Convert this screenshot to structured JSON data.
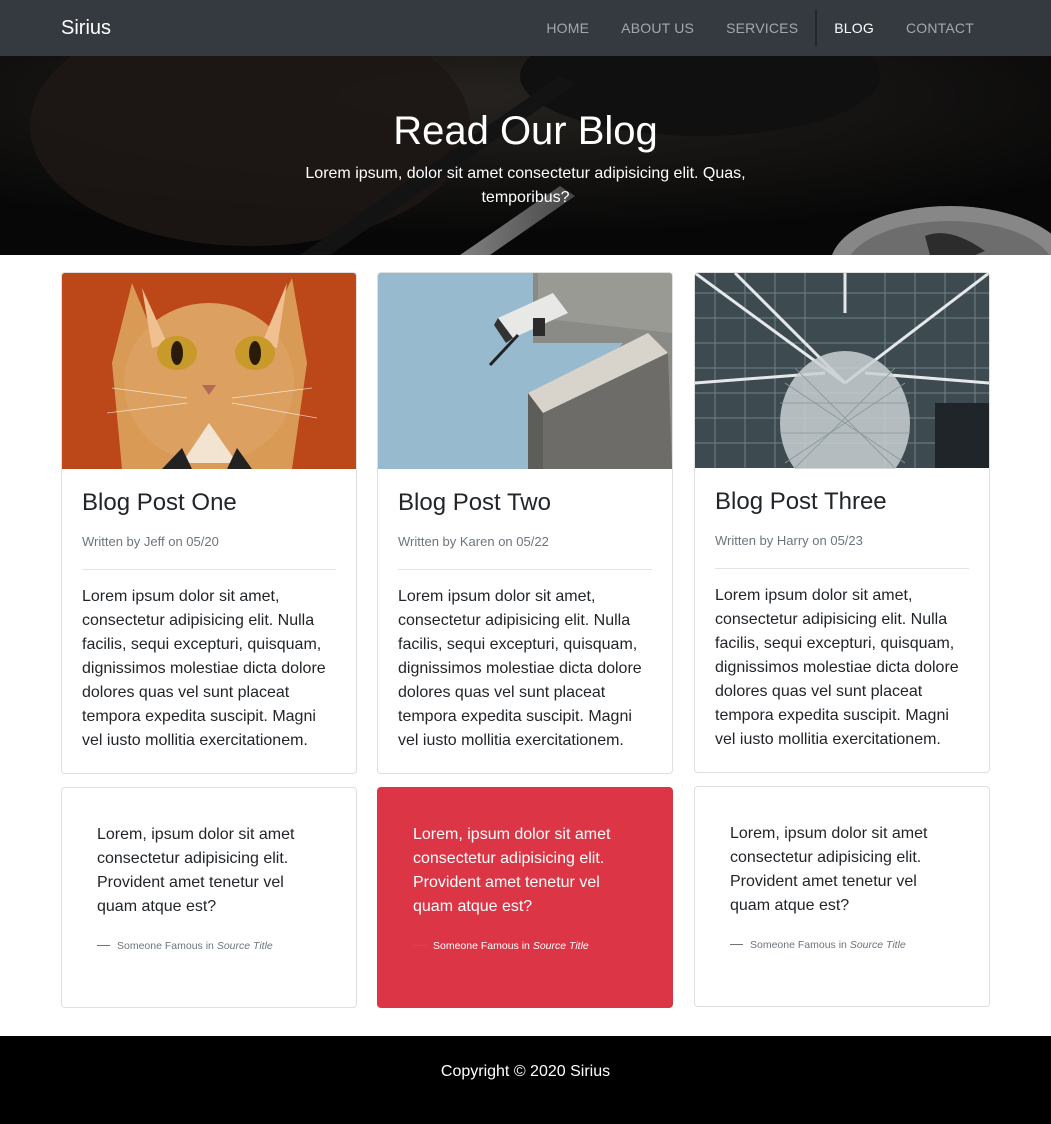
{
  "navbar": {
    "brand": "Sirius",
    "links": [
      {
        "label": "HOME"
      },
      {
        "label": "ABOUT US"
      },
      {
        "label": "SERVICES"
      },
      {
        "label": "BLOG"
      },
      {
        "label": "CONTACT"
      }
    ],
    "active": "BLOG"
  },
  "hero": {
    "title": "Read Our Blog",
    "subtitle": "Lorem ipsum, dolor sit amet consectetur adipisicing elit. Quas, temporibus?"
  },
  "posts": [
    {
      "title": "Blog Post One",
      "meta": "Written by Jeff on 05/20",
      "body": "Lorem ipsum dolor sit amet, consectetur adipisicing elit. Nulla facilis, sequi excepturi, quisquam, dignissimos molestiae dicta dolore dolores quas vel sunt placeat tempora expedita suscipit. Magni vel iusto mollitia exercitationem."
    },
    {
      "title": "Blog Post Two",
      "meta": "Written by Karen on 05/22",
      "body": "Lorem ipsum dolor sit amet, consectetur adipisicing elit. Nulla facilis, sequi excepturi, quisquam, dignissimos molestiae dicta dolore dolores quas vel sunt placeat tempora expedita suscipit. Magni vel iusto mollitia exercitationem."
    },
    {
      "title": "Blog Post Three",
      "meta": "Written by Harry on 05/23",
      "body": "Lorem ipsum dolor sit amet, consectetur adipisicing elit. Nulla facilis, sequi excepturi, quisquam, dignissimos molestiae dicta dolore dolores quas vel sunt placeat tempora expedita suscipit. Magni vel iusto mollitia exercitationem."
    }
  ],
  "quotes": [
    {
      "text": "Lorem, ipsum dolor sit amet consectetur adipisicing elit. Provident amet tenetur vel quam atque est?",
      "author": "Someone Famous in",
      "source": "Source Title"
    },
    {
      "text": "Lorem, ipsum dolor sit amet consectetur adipisicing elit. Provident amet tenetur vel quam atque est?",
      "author": "Someone Famous in",
      "source": "Source Title"
    },
    {
      "text": "Lorem, ipsum dolor sit amet consectetur adipisicing elit. Provident amet tenetur vel quam atque est?",
      "author": "Someone Famous in",
      "source": "Source Title"
    }
  ],
  "footer": {
    "copyright": "Copyright © 2020 Sirius"
  },
  "colors": {
    "navbar_bg": "#343a40",
    "quote_highlight": "#dc3545",
    "footer_bg": "#000000"
  }
}
